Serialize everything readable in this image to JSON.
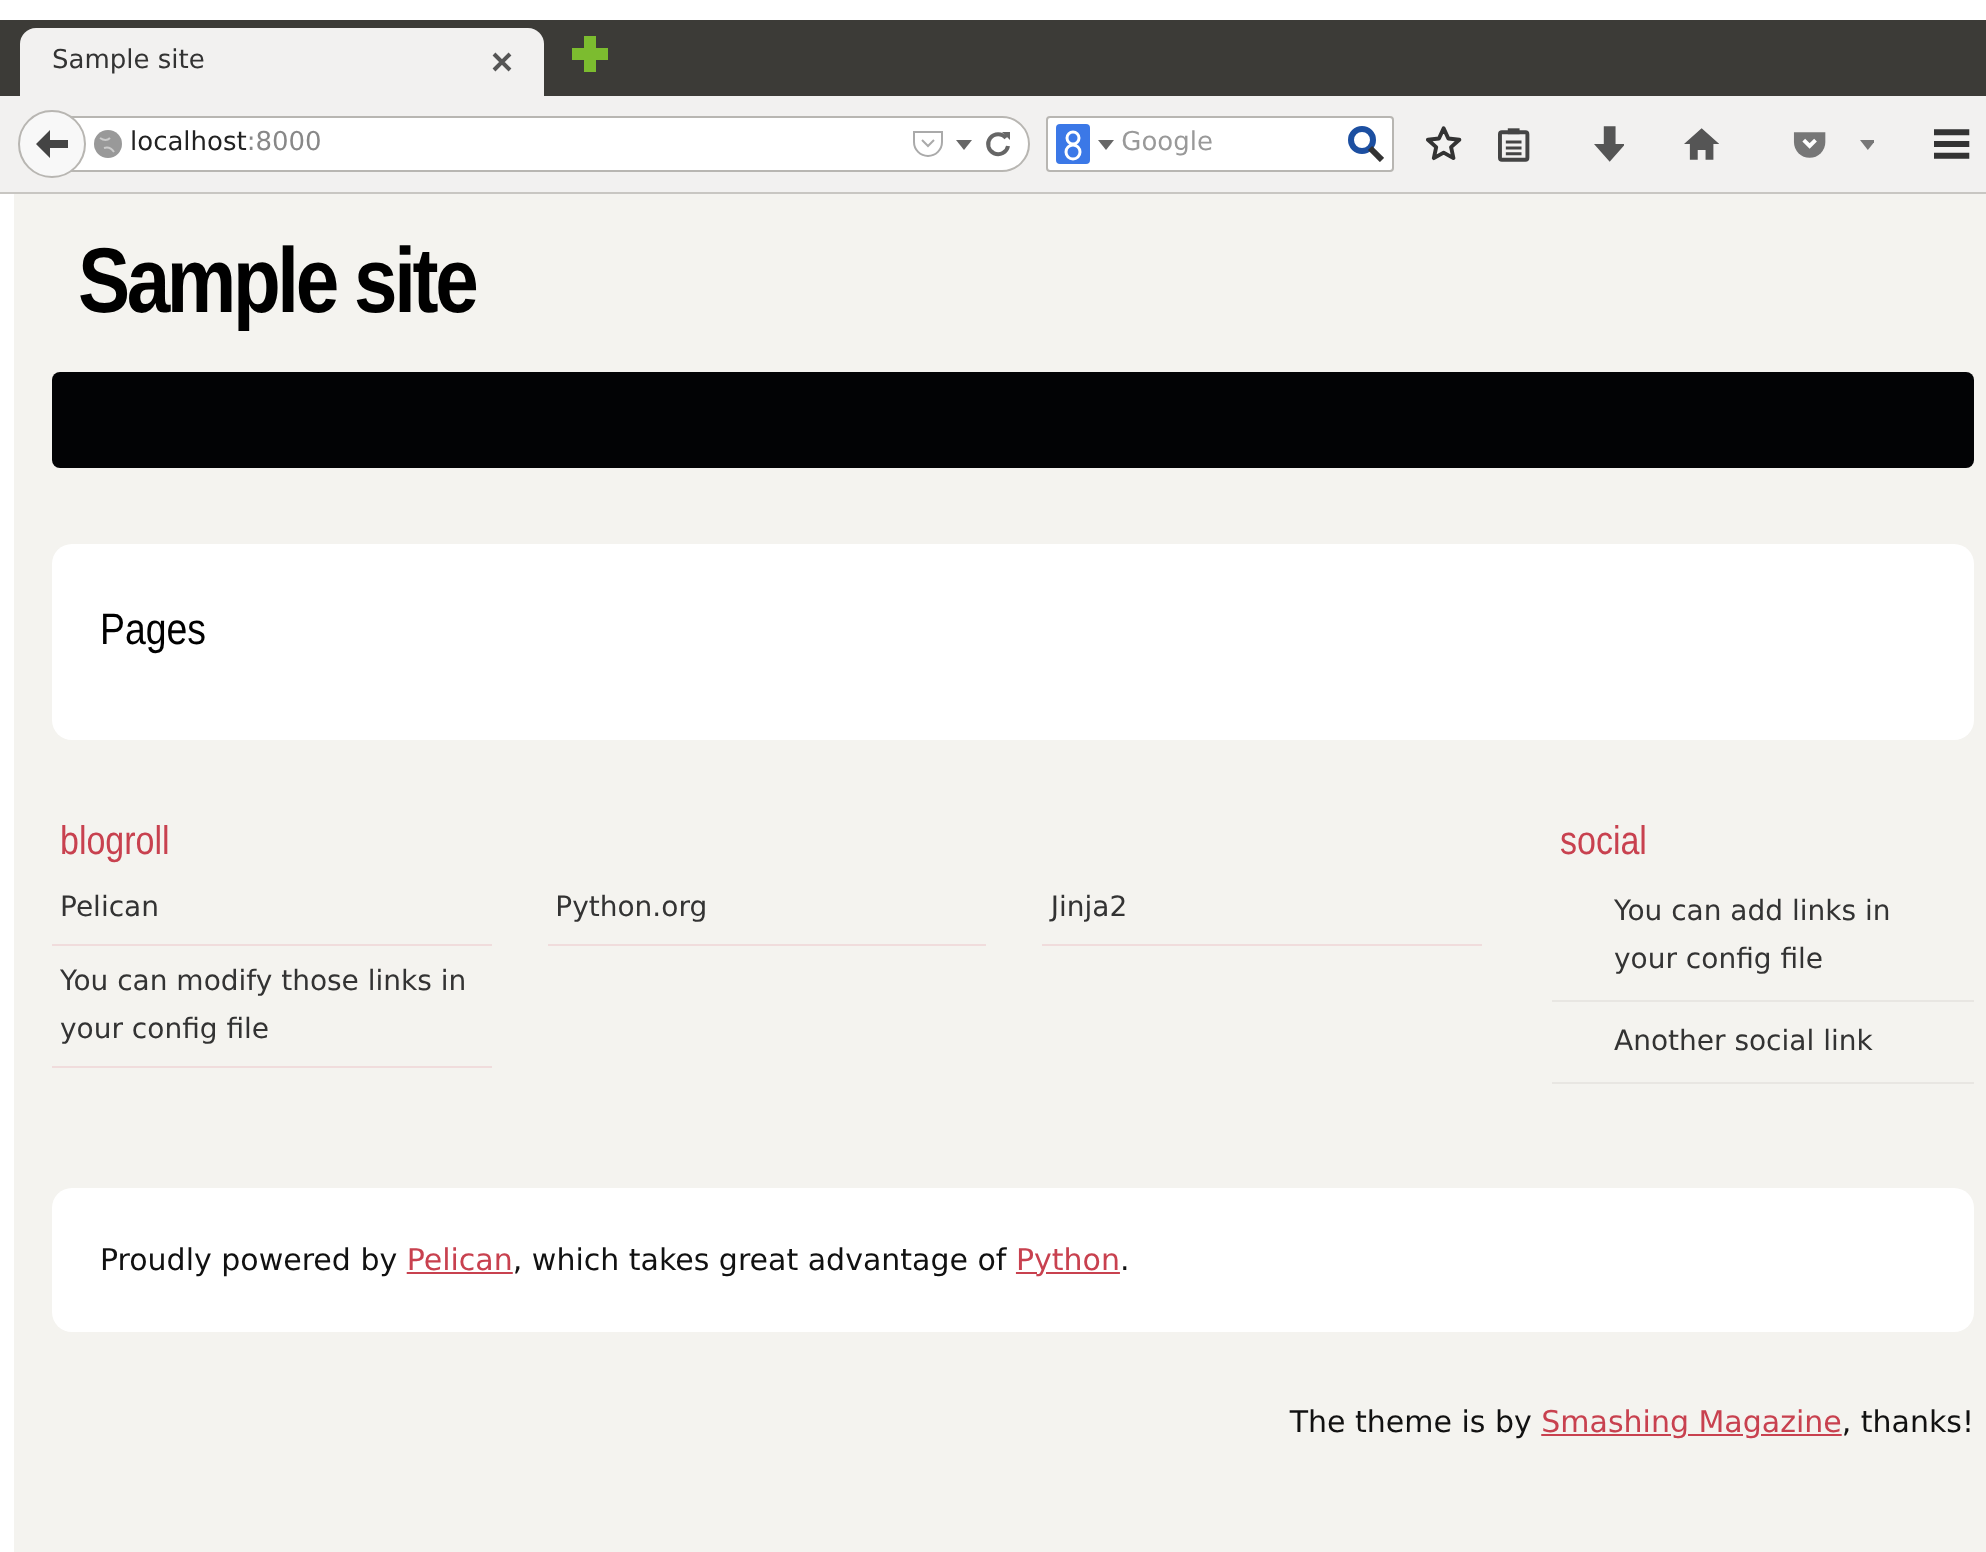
{
  "browser": {
    "tab": {
      "title": "Sample site",
      "selected": true
    },
    "url": {
      "host": "localhost",
      "port": ":8000"
    },
    "search": {
      "placeholder": "Google"
    }
  },
  "site": {
    "title": "Sample site"
  },
  "pages": {
    "title": "Pages"
  },
  "blogroll": {
    "title": "blogroll",
    "links": [
      "Pelican",
      "Python.org",
      "Jinja2",
      "You can modify those links in your config file"
    ]
  },
  "social": {
    "title": "social",
    "links": [
      "You can add links in your config file",
      "Another social link"
    ]
  },
  "footer": {
    "segments": [
      {
        "kind": "text",
        "text": "Proudly powered by "
      },
      {
        "kind": "link",
        "text": "Pelican"
      },
      {
        "kind": "text",
        "text": ", which takes great advantage of "
      },
      {
        "kind": "link",
        "text": "Python"
      },
      {
        "kind": "text",
        "text": "."
      }
    ]
  },
  "credit": {
    "segments": [
      {
        "kind": "text",
        "text": "The theme is by "
      },
      {
        "kind": "link",
        "text": "Smashing Magazine"
      },
      {
        "kind": "text",
        "text": ", thanks!"
      }
    ]
  }
}
